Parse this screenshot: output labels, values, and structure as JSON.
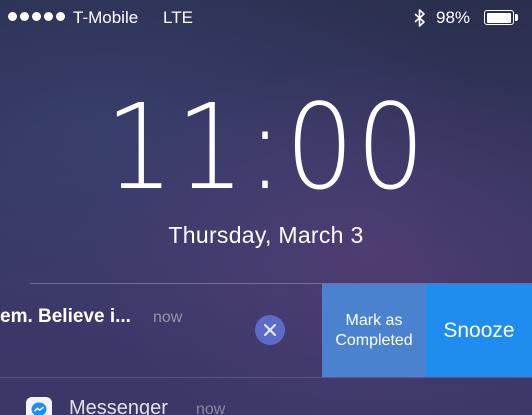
{
  "status_bar": {
    "signal_bars": 5,
    "carrier": "T-Mobile",
    "network": "LTE",
    "bluetooth_icon": "bluetooth-icon",
    "battery_percent": "98%",
    "battery_level": 0.98
  },
  "lock_screen": {
    "time": "11:00",
    "date": "Thursday, March 3"
  },
  "notification": {
    "text": "em. Believe i...",
    "time": "now",
    "clear_icon": "close-icon",
    "actions": {
      "mark_completed": "Mark as Completed",
      "snooze": "Snooze"
    },
    "colors": {
      "mark_completed_bg": "#4b82cf",
      "snooze_bg": "#1f8cf0",
      "clear_bg": "#5b6bc7"
    }
  },
  "next_notification": {
    "app_icon": "messenger-icon",
    "app_name": "Messenger",
    "time": "now"
  }
}
